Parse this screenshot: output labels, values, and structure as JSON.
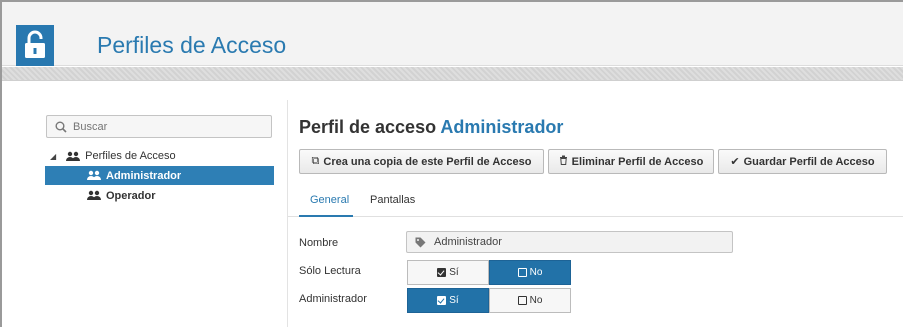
{
  "header": {
    "title": "Perfiles de Acceso",
    "accent": "#2a7ab0",
    "icon": "unlock-icon"
  },
  "sidebar": {
    "search": {
      "placeholder": "Buscar"
    },
    "tree": {
      "root_label": "Perfiles de Acceso",
      "items": [
        {
          "label": "Administrador",
          "selected": true
        },
        {
          "label": "Operador",
          "selected": false
        }
      ]
    }
  },
  "main": {
    "title_prefix": "Perfil de acceso",
    "title_name": "Administrador",
    "toolbar": {
      "copy_label": "Crea una copia de este Perfil de Acceso",
      "delete_label": "Eliminar Perfil de Acceso",
      "save_label": "Guardar Perfil de Acceso"
    },
    "tabs": [
      {
        "label": "General",
        "active": true
      },
      {
        "label": "Pantallas",
        "active": false
      }
    ],
    "form": {
      "nombre_label": "Nombre",
      "nombre_value": "Administrador",
      "solo_lectura_label": "Sólo Lectura",
      "solo_lectura": {
        "yes_label": "Sí",
        "no_label": "No",
        "selected": "no"
      },
      "administrador_label": "Administrador",
      "administrador": {
        "yes_label": "Sí",
        "no_label": "No",
        "selected": "yes"
      }
    }
  }
}
